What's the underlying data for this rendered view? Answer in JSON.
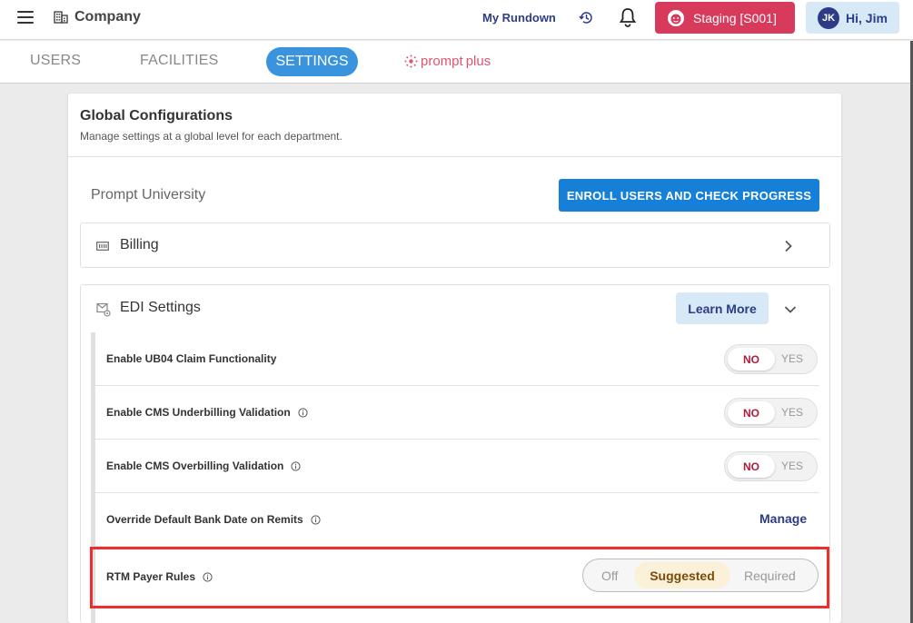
{
  "topbar": {
    "company": "Company",
    "rundown": "My Rundown",
    "staging": "Staging [S001]",
    "user_initials": "JK",
    "user_greeting": "Hi, Jim"
  },
  "tabs": {
    "users": "USERS",
    "facilities": "FACILITIES",
    "settings": "SETTINGS",
    "prompt_plus_a": "prompt",
    "prompt_plus_b": "plus"
  },
  "card": {
    "title": "Global Configurations",
    "subtitle": "Manage settings at a global level for each department.",
    "university": "Prompt University",
    "enroll_button": "ENROLL USERS AND CHECK PROGRESS",
    "billing": "Billing",
    "edi": "EDI Settings",
    "learn_more": "Learn More"
  },
  "rows": [
    {
      "label": "Enable UB04 Claim Functionality",
      "no": "NO",
      "yes": "YES"
    },
    {
      "label": "Enable CMS Underbilling Validation",
      "no": "NO",
      "yes": "YES"
    },
    {
      "label": "Enable CMS Overbilling Validation",
      "no": "NO",
      "yes": "YES"
    },
    {
      "label": "Override Default Bank Date on Remits",
      "action": "Manage"
    },
    {
      "label": "RTM Payer Rules",
      "options": [
        "Off",
        "Suggested",
        "Required"
      ],
      "selected": "Suggested"
    }
  ],
  "colors": {
    "staging": "#d83a5c",
    "primary": "#1680d8",
    "navy": "#2d3c85",
    "highlight": "#ee2d2d"
  }
}
